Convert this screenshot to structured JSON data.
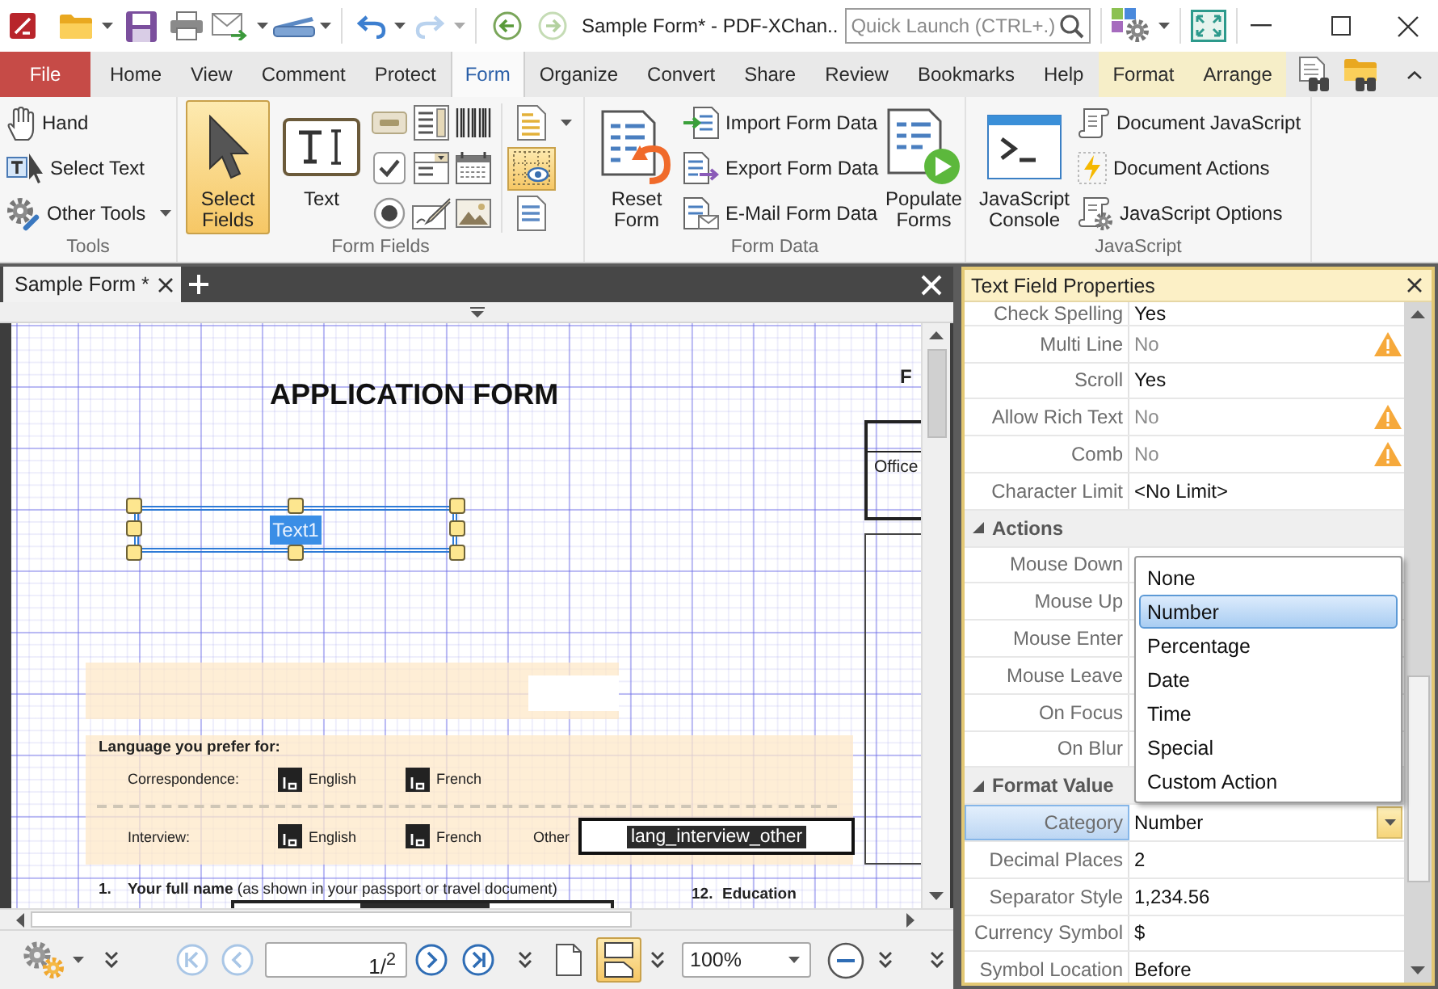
{
  "title_bar": {
    "title": "Sample Form* - PDF-XChan..",
    "search_placeholder": "Quick Launch (CTRL+.)",
    "redo_disabled": true,
    "forward_disabled": true
  },
  "menu_tabs": [
    {
      "label": "File",
      "kind": "file",
      "selected": false
    },
    {
      "label": "Home",
      "kind": "tab",
      "selected": false
    },
    {
      "label": "View",
      "kind": "tab",
      "selected": false
    },
    {
      "label": "Comment",
      "kind": "tab",
      "selected": false
    },
    {
      "label": "Protect",
      "kind": "tab",
      "selected": false
    },
    {
      "label": "Form",
      "kind": "tab",
      "selected": true
    },
    {
      "label": "Organize",
      "kind": "tab",
      "selected": false
    },
    {
      "label": "Convert",
      "kind": "tab",
      "selected": false
    },
    {
      "label": "Share",
      "kind": "tab",
      "selected": false
    },
    {
      "label": "Review",
      "kind": "tab",
      "selected": false
    },
    {
      "label": "Bookmarks",
      "kind": "tab",
      "selected": false
    },
    {
      "label": "Help",
      "kind": "tab",
      "selected": false
    },
    {
      "label": "Format",
      "kind": "contextual",
      "selected": false
    },
    {
      "label": "Arrange",
      "kind": "contextual",
      "selected": false
    }
  ],
  "ribbon": {
    "tools": {
      "label": "Tools",
      "buttons": [
        {
          "label": "Hand",
          "dropdown": false
        },
        {
          "label": "Select Text",
          "dropdown": false
        },
        {
          "label": "Other Tools",
          "dropdown": true
        }
      ]
    },
    "form_fields": {
      "label": "Form Fields",
      "select_fields": {
        "label": "Select Fields",
        "selected": true
      },
      "text_field": "Text",
      "toggles": [
        {
          "selected": false
        },
        {
          "selected": true
        },
        {
          "selected": false
        }
      ]
    },
    "form_data": {
      "label": "Form Data",
      "reset": "Reset Form",
      "buttons": [
        "Import Form Data",
        "Export Form Data",
        "E-Mail Form Data"
      ],
      "populate": "Populate Forms"
    },
    "javascript": {
      "label": "JavaScript",
      "console": "JavaScript Console",
      "buttons": [
        "Document JavaScript",
        "Document Actions",
        "JavaScript Options"
      ]
    }
  },
  "document": {
    "tab_title": "Sample Form *",
    "page": {
      "heading": "APPLICATION FORM",
      "side_heading": "F",
      "office_label": "Office",
      "selected_field": "Text1",
      "language": {
        "title": "Language you prefer for:",
        "rows": [
          {
            "label": "Correspondence:",
            "options": [
              "English",
              "French"
            ]
          },
          {
            "label": "Interview:",
            "options": [
              "English",
              "French"
            ],
            "other_label": "Other",
            "other_field": "lang_interview_other"
          }
        ]
      },
      "name_question": {
        "number": "1.",
        "text": "**Your full name** (as shown in your passport or travel document)"
      },
      "education_heading": {
        "number": "12.",
        "text": "Education"
      }
    }
  },
  "bottom_toolbar": {
    "nav_buttons": [
      {
        "disabled": true
      },
      {
        "disabled": true
      },
      {
        "disabled": false
      },
      {
        "disabled": false
      }
    ],
    "page_field": "1/$^{2}$",
    "layout_buttons": [
      {
        "selected": false
      },
      {
        "selected": true
      }
    ],
    "zoom": "100%"
  },
  "properties": {
    "title": "Text Field Properties",
    "rows": [
      {
        "kind": "property",
        "label": "Check Spelling",
        "value": "Yes",
        "disabled": false,
        "warning": false,
        "selected": false
      },
      {
        "kind": "property",
        "label": "Multi Line",
        "value": "No",
        "disabled": true,
        "warning": true,
        "selected": false
      },
      {
        "kind": "property",
        "label": "Scroll",
        "value": "Yes",
        "disabled": false,
        "warning": false,
        "selected": false
      },
      {
        "kind": "property",
        "label": "Allow Rich Text",
        "value": "No",
        "disabled": true,
        "warning": true,
        "selected": false
      },
      {
        "kind": "property",
        "label": "Comb",
        "value": "No",
        "disabled": true,
        "warning": true,
        "selected": false
      },
      {
        "kind": "property",
        "label": "Character Limit",
        "value": "<No Limit>",
        "disabled": false,
        "warning": false,
        "selected": false
      },
      {
        "kind": "section",
        "label": "Actions",
        "expanded": true,
        "selected": false
      },
      {
        "kind": "property",
        "label": "Mouse Down",
        "warning": false,
        "selected": false
      },
      {
        "kind": "property",
        "label": "Mouse Up",
        "warning": false,
        "selected": false
      },
      {
        "kind": "property",
        "label": "Mouse Enter",
        "warning": false,
        "selected": false
      },
      {
        "kind": "property",
        "label": "Mouse Leave",
        "warning": false,
        "selected": false
      },
      {
        "kind": "property",
        "label": "On Focus",
        "warning": false,
        "selected": false
      },
      {
        "kind": "property",
        "label": "On Blur",
        "warning": false,
        "selected": false
      },
      {
        "kind": "section",
        "label": "Format Value",
        "expanded": true,
        "selected": false
      },
      {
        "kind": "property",
        "label": "Category",
        "value": "Number",
        "disabled": false,
        "warning": false,
        "selected": true
      },
      {
        "kind": "property",
        "label": "Decimal Places",
        "value": "2",
        "disabled": false,
        "warning": false,
        "selected": false
      },
      {
        "kind": "property",
        "label": "Separator Style",
        "value": "1,234.56",
        "disabled": false,
        "warning": false,
        "selected": false
      },
      {
        "kind": "property",
        "label": "Currency Symbol",
        "value": "$",
        "disabled": false,
        "warning": false,
        "selected": false
      },
      {
        "kind": "property",
        "label": "Symbol Location",
        "value": "Before",
        "disabled": false,
        "warning": false,
        "selected": false
      }
    ],
    "category_dropdown": [
      {
        "label": "None",
        "selected": false
      },
      {
        "label": "Number",
        "selected": true
      },
      {
        "label": "Percentage",
        "selected": false
      },
      {
        "label": "Date",
        "selected": false
      },
      {
        "label": "Time",
        "selected": false
      },
      {
        "label": "Special",
        "selected": false
      },
      {
        "label": "Custom Action",
        "selected": false
      }
    ]
  }
}
